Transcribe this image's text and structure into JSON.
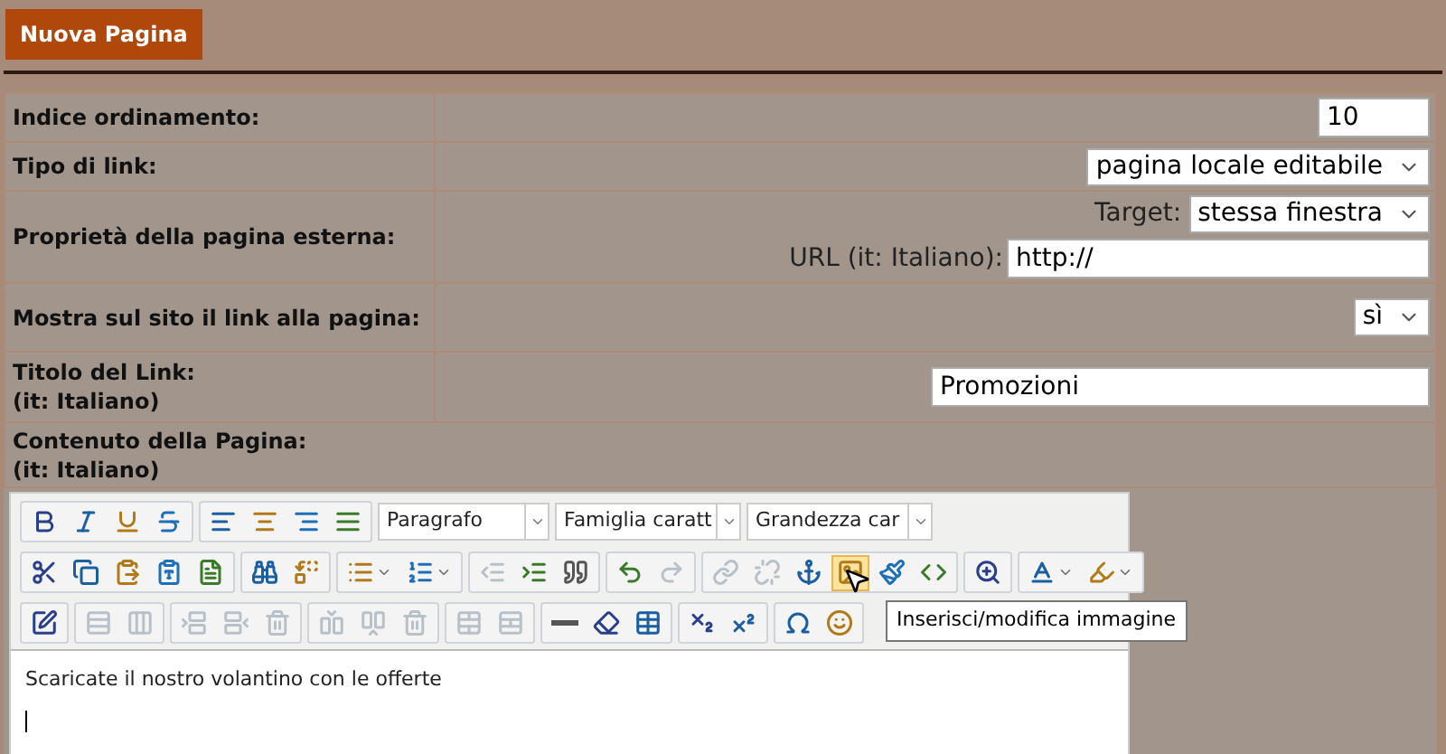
{
  "header_button": "Nuova Pagina",
  "form": {
    "rows": [
      {
        "kind": "input",
        "label": "Indice ordinamento:",
        "value": "10"
      },
      {
        "kind": "select",
        "label": "Tipo di link:",
        "value": "pagina locale editabile"
      },
      {
        "kind": "external",
        "label": "Proprietà della pagina esterna:",
        "target_label": "Target:",
        "target_value": "stessa finestra",
        "url_label": "URL (it: Italiano):",
        "url_value": "http://"
      },
      {
        "kind": "select",
        "label": "Mostra sul sito il link alla pagina:",
        "value": "sì"
      },
      {
        "kind": "title",
        "label": "Titolo del Link:",
        "sublabel": "(it: Italiano)",
        "value": "Promozioni"
      },
      {
        "kind": "heading",
        "label": "Contenuto della Pagina:",
        "sublabel": "(it: Italiano)"
      }
    ]
  },
  "editor": {
    "toolbar": [
      [
        {
          "kind": "group",
          "buttons": [
            {
              "disabled": false,
              "split": false,
              "highlighted": false
            },
            {
              "disabled": false,
              "split": false,
              "highlighted": false
            },
            {
              "disabled": false,
              "split": false,
              "highlighted": false
            },
            {
              "disabled": false,
              "split": false,
              "highlighted": false
            }
          ]
        },
        {
          "kind": "group",
          "buttons": [
            {
              "disabled": false,
              "split": false,
              "highlighted": false
            },
            {
              "disabled": false,
              "split": false,
              "highlighted": false
            },
            {
              "disabled": false,
              "split": false,
              "highlighted": false
            },
            {
              "disabled": false,
              "split": false,
              "highlighted": false
            }
          ]
        },
        {
          "kind": "select",
          "value": "Paragrafo"
        },
        {
          "kind": "select",
          "value": "Famiglia caratt"
        },
        {
          "kind": "select",
          "value": "Grandezza car"
        }
      ],
      [
        {
          "kind": "group",
          "buttons": [
            {
              "disabled": false,
              "split": false,
              "highlighted": false
            },
            {
              "disabled": false,
              "split": false,
              "highlighted": false
            },
            {
              "disabled": false,
              "split": false,
              "highlighted": false
            },
            {
              "disabled": false,
              "split": false,
              "highlighted": false
            },
            {
              "disabled": false,
              "split": false,
              "highlighted": false
            }
          ]
        },
        {
          "kind": "group",
          "buttons": [
            {
              "disabled": false,
              "split": false,
              "highlighted": false
            },
            {
              "disabled": false,
              "split": false,
              "highlighted": false
            }
          ]
        },
        {
          "kind": "group",
          "buttons": [
            {
              "disabled": false,
              "split": true,
              "highlighted": false
            },
            {
              "disabled": false,
              "split": true,
              "highlighted": false
            }
          ]
        },
        {
          "kind": "group",
          "buttons": [
            {
              "disabled": true,
              "split": false,
              "highlighted": false
            },
            {
              "disabled": false,
              "split": false,
              "highlighted": false
            },
            {
              "disabled": false,
              "split": false,
              "highlighted": false
            }
          ]
        },
        {
          "kind": "group",
          "buttons": [
            {
              "disabled": false,
              "split": false,
              "highlighted": false
            },
            {
              "disabled": true,
              "split": false,
              "highlighted": false
            }
          ]
        },
        {
          "kind": "group",
          "buttons": [
            {
              "disabled": true,
              "split": false,
              "highlighted": false
            },
            {
              "disabled": true,
              "split": false,
              "highlighted": false
            },
            {
              "disabled": false,
              "split": false,
              "highlighted": false
            },
            {
              "disabled": false,
              "split": false,
              "highlighted": true
            },
            {
              "disabled": false,
              "split": false,
              "highlighted": false
            },
            {
              "disabled": false,
              "split": false,
              "highlighted": false
            }
          ]
        },
        {
          "kind": "group",
          "buttons": [
            {
              "disabled": false,
              "split": false,
              "highlighted": false
            }
          ]
        },
        {
          "kind": "group",
          "buttons": [
            {
              "disabled": false,
              "split": true,
              "highlighted": false
            },
            {
              "disabled": false,
              "split": true,
              "highlighted": false
            }
          ]
        }
      ],
      [
        {
          "kind": "group",
          "buttons": [
            {
              "disabled": false,
              "split": false,
              "highlighted": false
            }
          ]
        },
        {
          "kind": "group",
          "buttons": [
            {
              "disabled": true,
              "split": false,
              "highlighted": false
            },
            {
              "disabled": true,
              "split": false,
              "highlighted": false
            }
          ]
        },
        {
          "kind": "group",
          "buttons": [
            {
              "disabled": true,
              "split": false,
              "highlighted": false
            },
            {
              "disabled": true,
              "split": false,
              "highlighted": false
            },
            {
              "disabled": true,
              "split": false,
              "highlighted": false
            }
          ]
        },
        {
          "kind": "group",
          "buttons": [
            {
              "disabled": true,
              "split": false,
              "highlighted": false
            },
            {
              "disabled": true,
              "split": false,
              "highlighted": false
            },
            {
              "disabled": true,
              "split": false,
              "highlighted": false
            }
          ]
        },
        {
          "kind": "group",
          "buttons": [
            {
              "disabled": true,
              "split": false,
              "highlighted": false
            },
            {
              "disabled": true,
              "split": false,
              "highlighted": false
            }
          ]
        },
        {
          "kind": "group",
          "buttons": [
            {
              "disabled": false,
              "split": false,
              "highlighted": false
            },
            {
              "disabled": false,
              "split": false,
              "highlighted": false
            },
            {
              "disabled": false,
              "split": false,
              "highlighted": false
            }
          ]
        },
        {
          "kind": "group",
          "buttons": [
            {
              "disabled": false,
              "split": false,
              "highlighted": false
            },
            {
              "disabled": false,
              "split": false,
              "highlighted": false
            }
          ]
        },
        {
          "kind": "group",
          "buttons": [
            {
              "disabled": false,
              "split": false,
              "highlighted": false
            },
            {
              "disabled": false,
              "split": false,
              "highlighted": false
            }
          ]
        }
      ]
    ],
    "tooltip": "Inserisci/modifica immagine",
    "content": "Scaricate il nostro volantino con le offerte"
  }
}
